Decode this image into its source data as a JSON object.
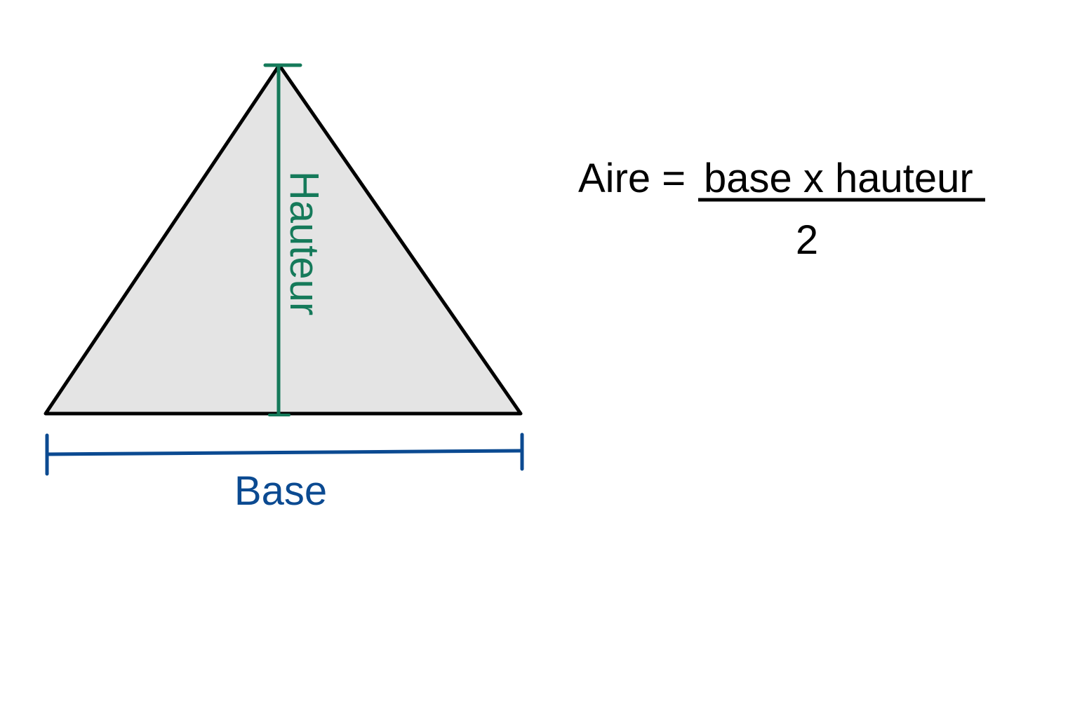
{
  "labels": {
    "height": "Hauteur",
    "base": "Base"
  },
  "formula": {
    "lhs": "Aire =",
    "numerator": "base x hauteur",
    "denominator": "2"
  },
  "colors": {
    "triangle_fill": "#e4e4e4",
    "triangle_stroke": "#000000",
    "height_color": "#157a5a",
    "base_color": "#0b4a91",
    "text_color": "#000000",
    "background": "#ffffff"
  }
}
